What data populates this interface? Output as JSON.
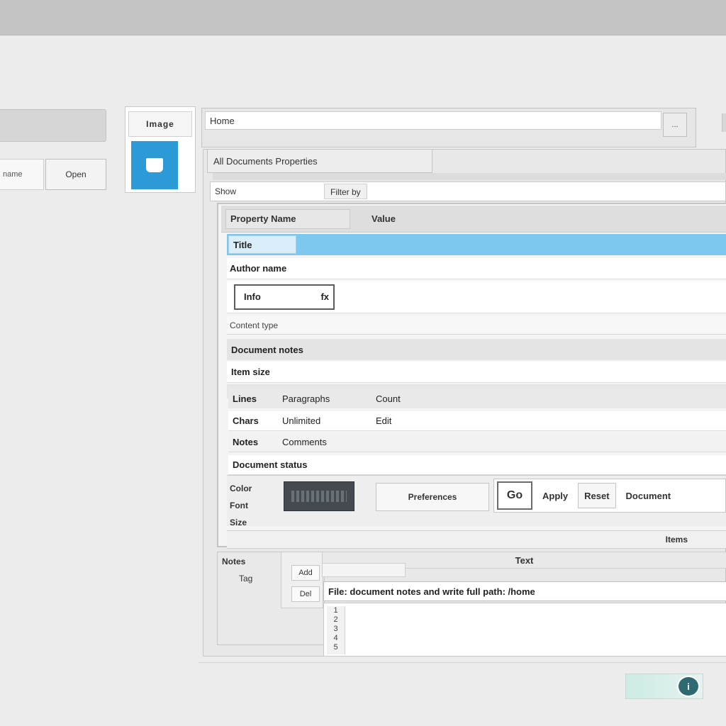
{
  "sidebar": {
    "field_label": "name",
    "button_label": "Open"
  },
  "thumbnail": {
    "label": "Image"
  },
  "path_bar": {
    "value": "Home",
    "button_label": "..."
  },
  "panel": {
    "title": "All Documents Properties",
    "filter_label": "Show",
    "filter_value": "Filter by"
  },
  "list": {
    "header_col1": "Property Name",
    "header_col2": "Value",
    "rows": [
      {
        "label": "Title"
      },
      {
        "label": "Author name"
      },
      {
        "input_value": "Info",
        "input_suffix": "fx"
      },
      {
        "label": "Content type"
      },
      {
        "label": "Document notes"
      },
      {
        "label": "Item size"
      }
    ],
    "props": [
      {
        "key": "Lines",
        "value": "Paragraphs",
        "extra": "Count"
      },
      {
        "key": "Chars",
        "value": "Unlimited",
        "extra": "Edit"
      },
      {
        "key": "Notes",
        "value": "Comments",
        "extra": ""
      },
      {
        "key": "Document status",
        "value": "",
        "extra": ""
      }
    ]
  },
  "toolbar": {
    "labels": [
      "Color",
      "Font",
      "Size"
    ],
    "field_label": "Preferences",
    "icon_button_label": "Go",
    "button_1": "Apply",
    "button_2": "Reset",
    "button_3": "Document"
  },
  "list_footer": {
    "text": "Items"
  },
  "bottom": {
    "left_label": "Notes",
    "left_sublabel": "Tag",
    "mid_buttons": [
      "Add",
      "Del"
    ],
    "head_label": "Text",
    "path_text": "File: document notes and write full path: /home",
    "gutter_lines": [
      "1",
      "2",
      "3",
      "4",
      "5"
    ]
  },
  "status": {
    "icon_label": "i"
  }
}
